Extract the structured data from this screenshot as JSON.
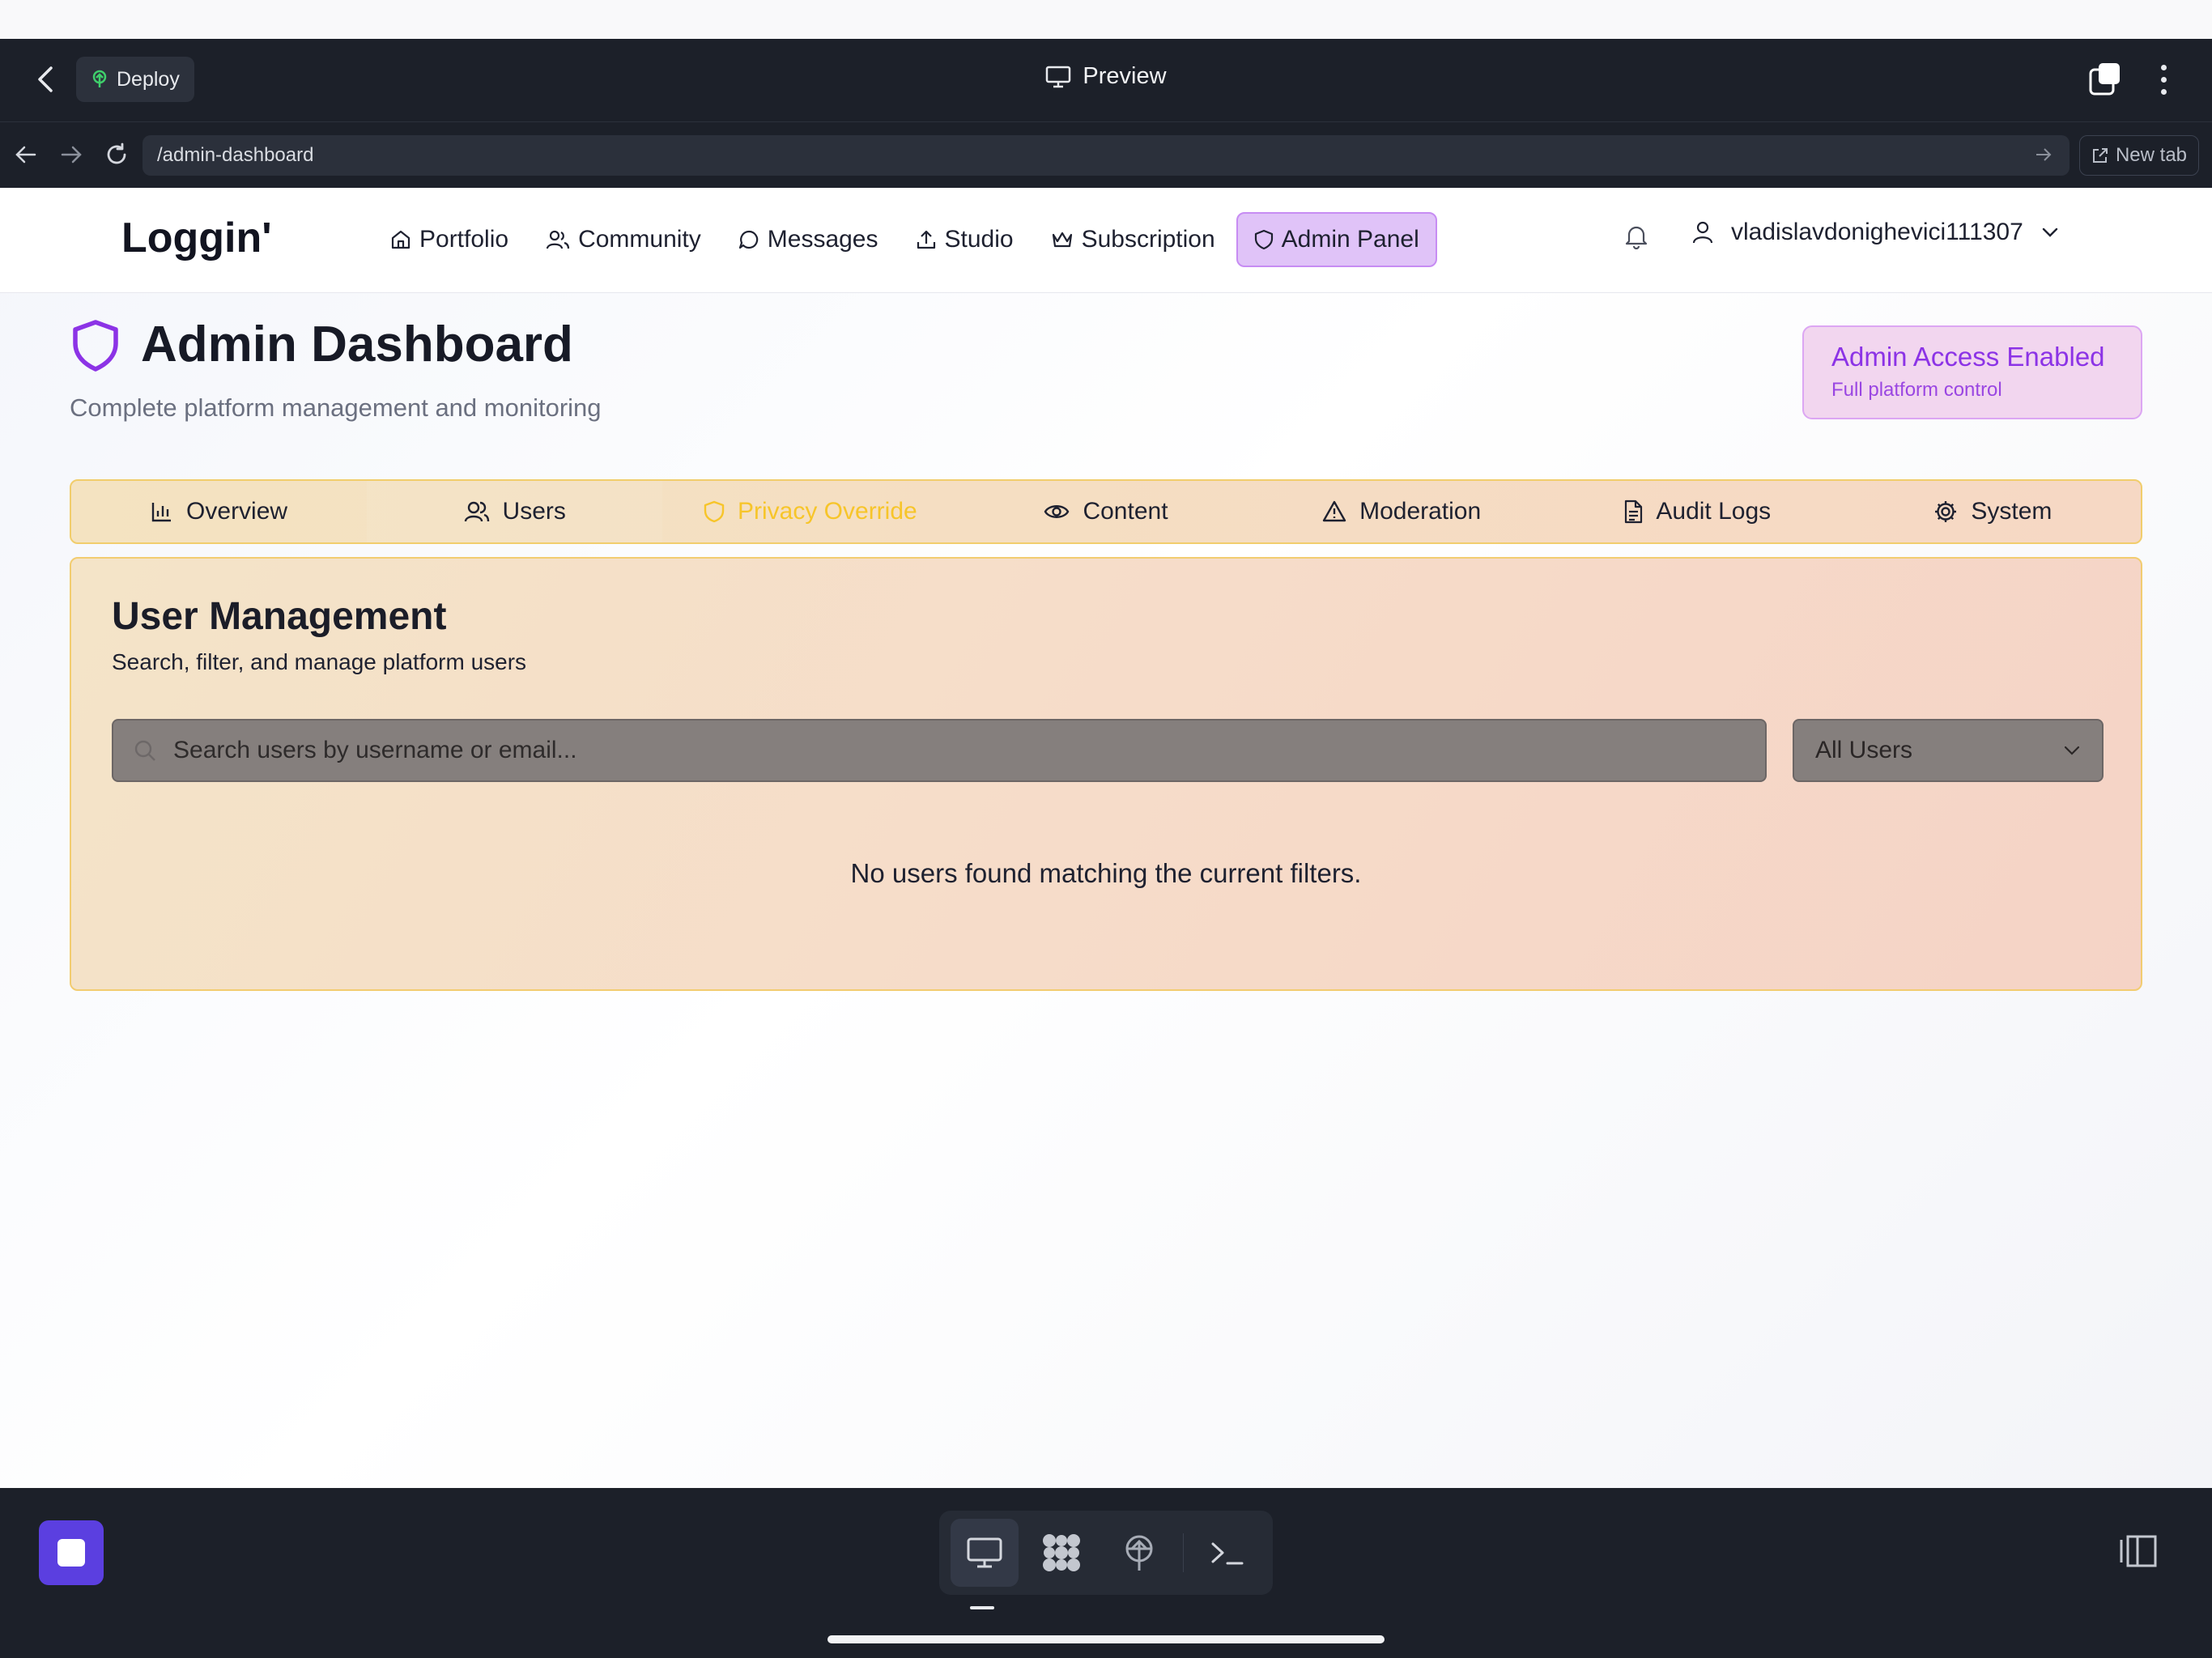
{
  "topbar": {
    "deploy_label": "Deploy",
    "preview_title": "Preview"
  },
  "urlbar": {
    "url": "/admin-dashboard",
    "new_tab_label": "New tab"
  },
  "app": {
    "logo": "Loggin'",
    "nav": [
      {
        "label": "Portfolio",
        "icon": "home-icon"
      },
      {
        "label": "Community",
        "icon": "users-icon"
      },
      {
        "label": "Messages",
        "icon": "message-circle-icon"
      },
      {
        "label": "Studio",
        "icon": "upload-icon"
      },
      {
        "label": "Subscription",
        "icon": "crown-icon"
      },
      {
        "label": "Admin Panel",
        "icon": "shield-icon",
        "active": true
      }
    ],
    "username": "vladislavdonighevici111307"
  },
  "page": {
    "title": "Admin Dashboard",
    "subtitle": "Complete platform management and monitoring",
    "access_badge": {
      "title": "Admin Access Enabled",
      "subtitle": "Full platform control"
    }
  },
  "tabs": [
    {
      "label": "Overview",
      "icon": "bar-chart-icon"
    },
    {
      "label": "Users",
      "icon": "users-icon",
      "selected": true
    },
    {
      "label": "Privacy Override",
      "icon": "shield-icon",
      "highlighted": true
    },
    {
      "label": "Content",
      "icon": "eye-icon"
    },
    {
      "label": "Moderation",
      "icon": "alert-triangle-icon"
    },
    {
      "label": "Audit Logs",
      "icon": "file-text-icon"
    },
    {
      "label": "System",
      "icon": "settings-icon"
    }
  ],
  "user_management": {
    "title": "User Management",
    "subtitle": "Search, filter, and manage platform users",
    "search_placeholder": "Search users by username or email...",
    "filter_value": "All Users",
    "empty_message": "No users found matching the current filters."
  },
  "colors": {
    "accent_purple": "#8c33e6",
    "highlight_yellow": "#f7c52a",
    "dark_chrome": "#1c2029",
    "stop_button": "#5b3fe0"
  }
}
